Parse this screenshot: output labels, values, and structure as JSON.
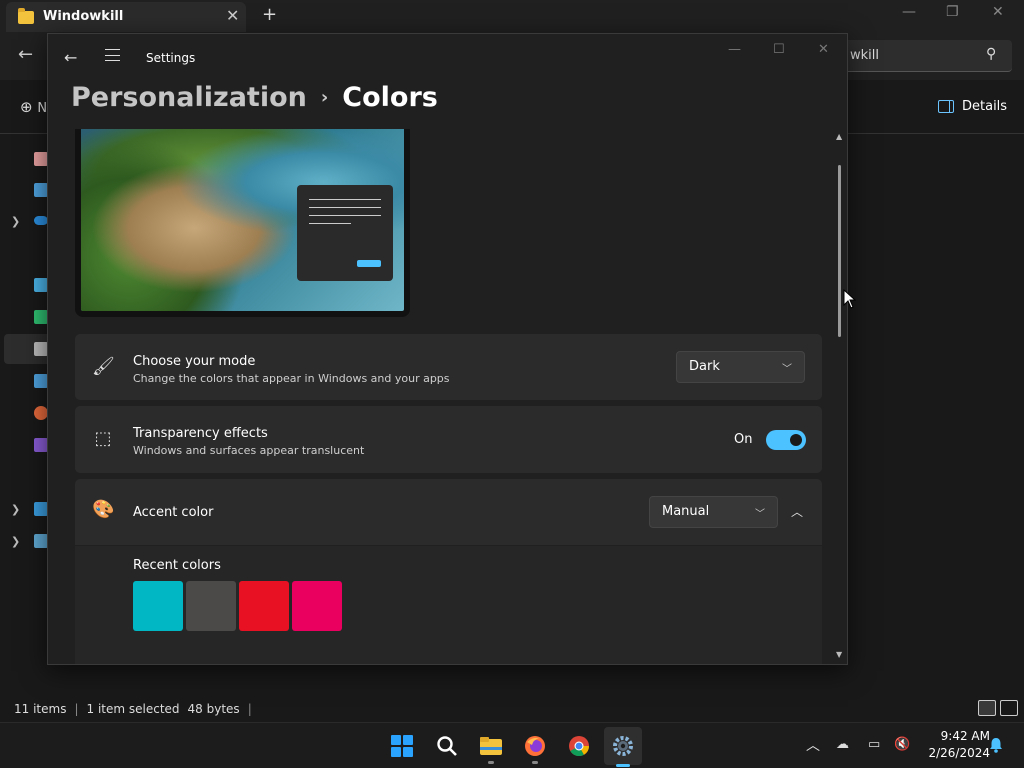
{
  "explorer": {
    "tab_title": "Windowkill",
    "close_tab": "✕",
    "new_tab": "+",
    "search_text": "wkill",
    "new_button": "N",
    "details_label": "Details",
    "status": {
      "items": "11 items",
      "selected": "1 item selected",
      "size": "48 bytes"
    }
  },
  "settings": {
    "app_title": "Settings",
    "breadcrumb_parent": "Personalization",
    "breadcrumb_sep": "›",
    "breadcrumb_current": "Colors",
    "mode": {
      "title": "Choose your mode",
      "subtitle": "Change the colors that appear in Windows and your apps",
      "value": "Dark"
    },
    "transparency": {
      "title": "Transparency effects",
      "subtitle": "Windows and surfaces appear translucent",
      "state_label": "On",
      "on": true
    },
    "accent": {
      "title": "Accent color",
      "value": "Manual",
      "recent_label": "Recent colors",
      "recent_colors": [
        "#00b7c3",
        "#4c4a48",
        "#e81123",
        "#ea005e"
      ]
    },
    "scrollbar": {
      "thumb_top_fraction": 0.06,
      "thumb_size_fraction": 0.33
    }
  },
  "taskbar": {
    "apps": [
      "start-icon",
      "search-icon",
      "file-explorer-icon",
      "firefox-icon",
      "chrome-icon",
      "settings-icon"
    ],
    "active_app": "settings-icon",
    "time": "9:42 AM",
    "date": "2/26/2024"
  },
  "colors": {
    "accent": "#4cc2ff",
    "window_bg": "#202020",
    "card_bg": "#2b2b2b"
  }
}
